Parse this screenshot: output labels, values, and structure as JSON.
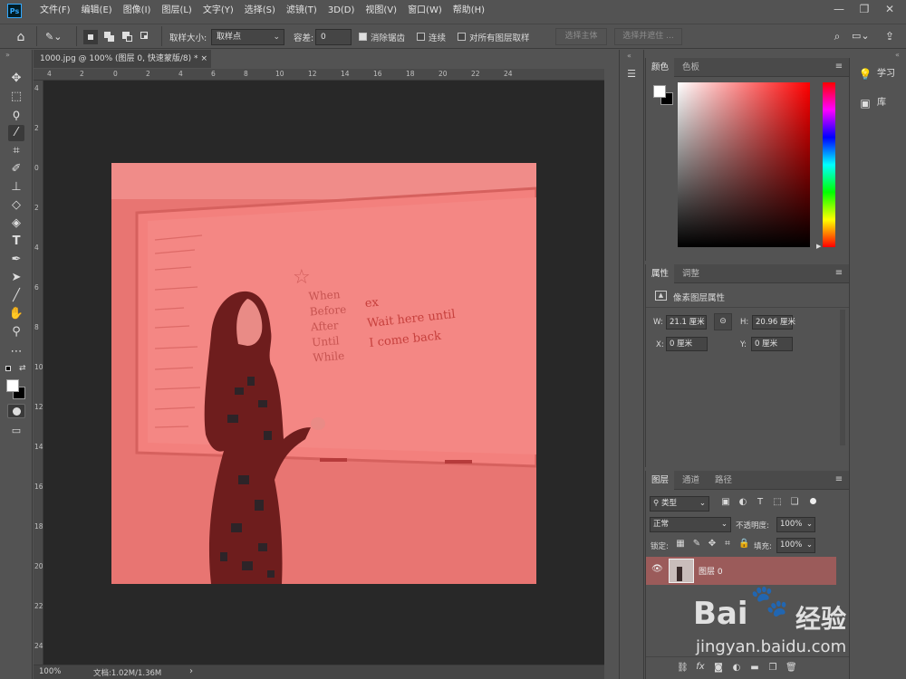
{
  "app": {
    "logo": "Ps"
  },
  "menubar": {
    "items": [
      "文件(F)",
      "编辑(E)",
      "图像(I)",
      "图层(L)",
      "文字(Y)",
      "选择(S)",
      "滤镜(T)",
      "3D(D)",
      "视图(V)",
      "窗口(W)",
      "帮助(H)"
    ],
    "window_controls": [
      "—",
      "❐",
      "✕"
    ]
  },
  "options_bar": {
    "sample_size_label": "取样大小:",
    "sample_size_value": "取样点",
    "tolerance_label": "容差:",
    "tolerance_value": "0",
    "antialias_label": "消除锯齿",
    "antialias_checked": true,
    "contiguous_label": "连续",
    "contiguous_checked": false,
    "sample_all_label": "对所有图层取样",
    "sample_all_checked": false,
    "select_subject_label": "选择主体",
    "select_mask_label": "选择并遮住 ..."
  },
  "document": {
    "tab_title": "1000.jpg @ 100% (图层 0, 快速蒙版/8) *",
    "tab_close": "×",
    "hruler_labels": [
      "4",
      "2",
      "0",
      "2",
      "4",
      "6",
      "8",
      "10",
      "12",
      "14",
      "16",
      "18",
      "20",
      "22",
      "24"
    ],
    "vruler_labels": [
      "4",
      "2",
      "0",
      "2",
      "4",
      "6",
      "8",
      "10",
      "12",
      "14",
      "16",
      "18",
      "20",
      "22",
      "24"
    ],
    "whiteboard_text_left": [
      "When",
      "Before",
      "After",
      "Until",
      "While"
    ],
    "whiteboard_text_right": [
      "ex",
      "Wait here until",
      "I come back"
    ],
    "overlay_color": "#e8635f"
  },
  "statusbar": {
    "zoom": "100%",
    "doc_size": "文档:1.02M/1.36M",
    "arrow": "›"
  },
  "color_panel": {
    "tabs": [
      "颜色",
      "色板"
    ],
    "active_tab": 0,
    "foreground": "#ffffff",
    "background": "#000000",
    "hue": "#ff0000"
  },
  "properties_panel": {
    "tabs": [
      "属性",
      "调整"
    ],
    "active_tab": 0,
    "section_title": "像素图层属性",
    "w_label": "W:",
    "w_value": "21.1 厘米",
    "h_label": "H:",
    "h_value": "20.96 厘米",
    "x_label": "X:",
    "x_value": "0 厘米",
    "y_label": "Y:",
    "y_value": "0 厘米"
  },
  "layers_panel": {
    "tabs": [
      "图层",
      "通道",
      "路径"
    ],
    "active_tab": 0,
    "filter_label": "类型",
    "blend_mode": "正常",
    "opacity_label": "不透明度:",
    "opacity_value": "100%",
    "lock_label": "锁定:",
    "fill_label": "填充:",
    "fill_value": "100%",
    "layers": [
      {
        "name": "图层 0",
        "visible": true,
        "selected": true
      }
    ],
    "footer_icons": [
      "link-icon",
      "fx-icon",
      "mask-icon",
      "adjustment-icon",
      "group-icon",
      "new-layer-icon",
      "trash-icon"
    ]
  },
  "side_panel": {
    "items": [
      {
        "label": "学习",
        "icon": "lightbulb-icon"
      },
      {
        "label": "库",
        "icon": "library-icon"
      }
    ]
  },
  "watermark": {
    "brand": "Bai",
    "brand_suffix": "经验",
    "url": "jingyan.baidu.com"
  }
}
